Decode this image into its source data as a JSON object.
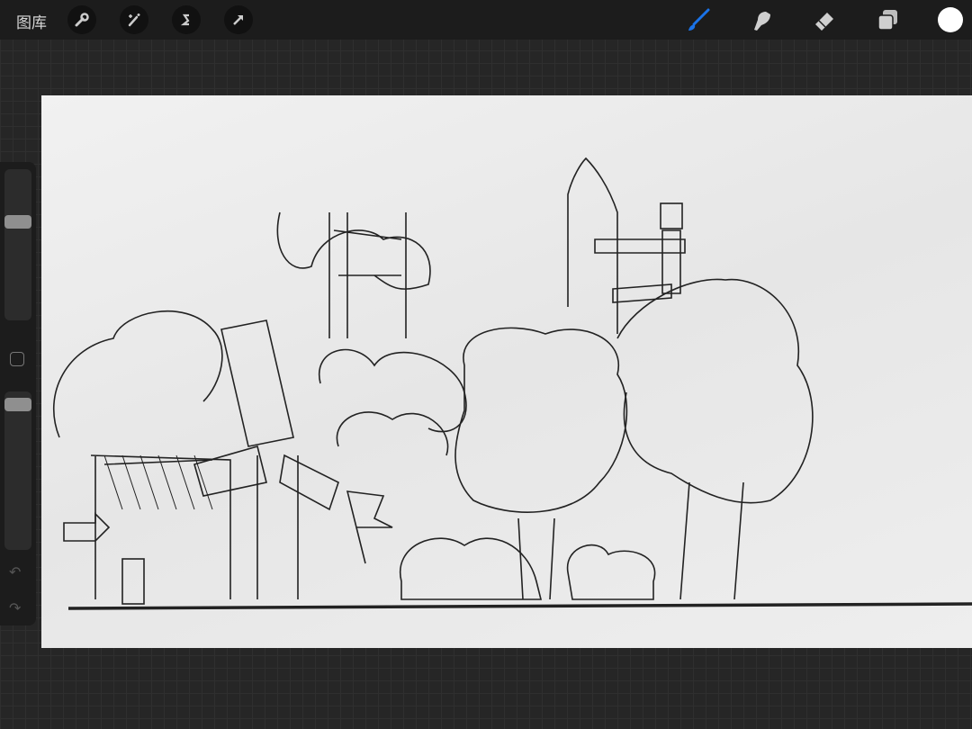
{
  "topbar": {
    "gallery_label": "图库",
    "tools_left": [
      "wrench-icon",
      "magic-wand-icon",
      "selection-icon",
      "transform-arrow-icon"
    ],
    "tools_right": [
      "brush-icon",
      "smudge-icon",
      "eraser-icon",
      "layers-icon",
      "color-swatch"
    ]
  },
  "colors": {
    "active_tool": "#1a73e8",
    "current_color": "#ffffff"
  },
  "sidebar": {
    "brush_size_fraction": 0.35,
    "opacity_fraction": 0.05,
    "undo": "↶",
    "redo": "↷"
  }
}
